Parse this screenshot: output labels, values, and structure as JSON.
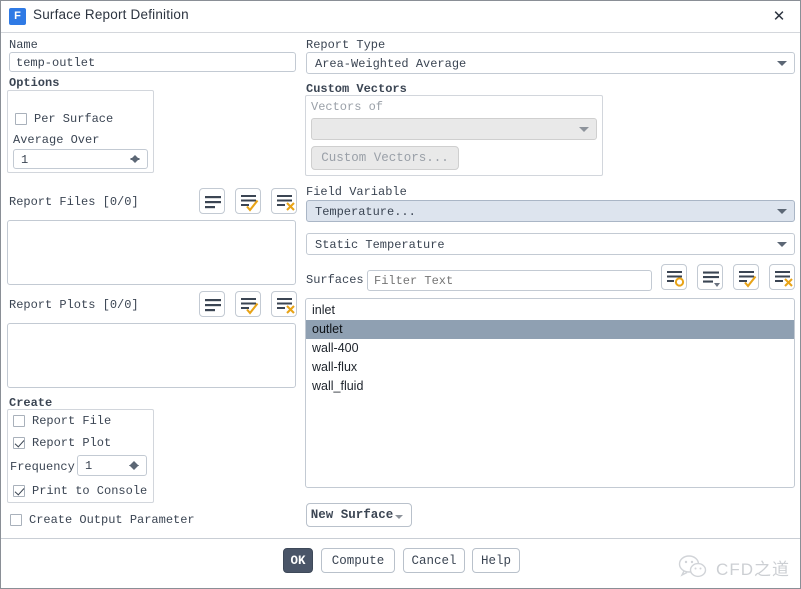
{
  "window": {
    "title": "Surface Report Definition",
    "icon_letter": "F",
    "close_label": "✕"
  },
  "left": {
    "name_label": "Name",
    "name_value": "temp-outlet",
    "options_label": "Options",
    "per_surface_label": "Per Surface",
    "per_surface_checked": false,
    "average_over_label": "Average Over",
    "average_over_value": "1",
    "report_files_label": "Report Files [0/0]",
    "report_plots_label": "Report Plots [0/0]",
    "create_label": "Create",
    "report_file_label": "Report File",
    "report_file_checked": false,
    "report_plot_label": "Report Plot",
    "report_plot_checked": true,
    "frequency_label": "Frequency",
    "frequency_value": "1",
    "print_to_console_label": "Print to Console",
    "print_to_console_checked": true,
    "create_output_parameter_label": "Create Output Parameter",
    "create_output_parameter_checked": false
  },
  "right": {
    "report_type_label": "Report Type",
    "report_type_value": "Area-Weighted Average",
    "custom_vectors_label": "Custom Vectors",
    "vectors_of_label": "Vectors of",
    "vectors_of_value": "",
    "custom_vectors_button": "Custom Vectors...",
    "field_variable_label": "Field Variable",
    "field_variable_value": "Temperature...",
    "field_variable_sub_value": "Static Temperature",
    "surfaces_label": "Surfaces",
    "surfaces_filter_placeholder": "Filter Text",
    "surfaces_filter_value": "",
    "surfaces": [
      {
        "label": "inlet",
        "selected": false
      },
      {
        "label": "outlet",
        "selected": true
      },
      {
        "label": "wall-400",
        "selected": false
      },
      {
        "label": "wall-flux",
        "selected": false
      },
      {
        "label": "wall_fluid",
        "selected": false
      }
    ],
    "new_surface_button": "New Surface"
  },
  "footer": {
    "ok": "OK",
    "compute": "Compute",
    "cancel": "Cancel",
    "help": "Help"
  },
  "watermark": {
    "text": "CFD之道"
  },
  "icons": {
    "list_all": "list-lines-icon",
    "list_check": "list-check-icon",
    "list_clear": "list-clear-icon",
    "list_circle": "list-circle-icon",
    "list_dropdown": "list-dropdown-icon"
  },
  "colors": {
    "accent_orange": "#e8a317",
    "selection": "#8fa0b2",
    "primary_button": "#4a5568"
  }
}
